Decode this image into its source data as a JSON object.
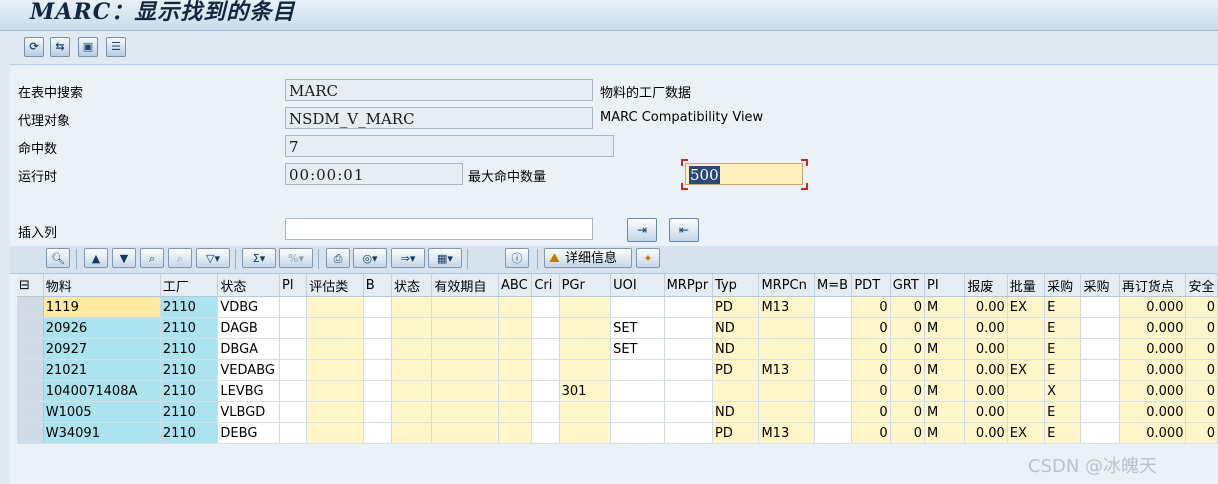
{
  "title": "MARC：显示找到的条目",
  "toolbar": {
    "icons": [
      "refresh-icon",
      "search-table-icon",
      "select-icon",
      "list-icon"
    ]
  },
  "form": {
    "table_label": "在表中搜索",
    "table_value": "MARC",
    "table_desc": "物料的工厂数据",
    "proxy_label": "代理对象",
    "proxy_value": "NSDM_V_MARC",
    "proxy_desc": "MARC Compatibility View",
    "hits_label": "命中数",
    "hits_value": "7",
    "runtime_label": "运行时",
    "runtime_value": "00:00:01",
    "max_hits_label": "最大命中数量",
    "max_hits_value": "500",
    "insert_col_label": "插入列",
    "insert_col_value": ""
  },
  "alv_toolbar": {
    "detail_label": "详细信息"
  },
  "grid": {
    "headers": [
      "物料",
      "工厂",
      "状态",
      "Pl",
      "评估类",
      "B",
      "状态",
      "有效期自",
      "ABC",
      "Cri",
      "PGr",
      "UOI",
      "MRPpr",
      "Typ",
      "MRPCn",
      "M=B",
      "PDT",
      "GRT",
      "PI",
      "报废",
      "批量",
      "采购",
      "采购",
      "再订货点",
      "安全"
    ],
    "rows": [
      [
        "1119",
        "2110",
        "VDBG",
        "",
        "",
        "",
        "",
        "",
        "",
        "",
        "",
        "",
        "",
        "PD",
        "M13",
        "",
        "0",
        "0",
        "M",
        "0.00",
        "EX",
        "E",
        "",
        "0.000",
        "0"
      ],
      [
        "20926",
        "2110",
        "DAGB",
        "",
        "",
        "",
        "",
        "",
        "",
        "",
        "",
        "SET",
        "",
        "ND",
        "",
        "",
        "0",
        "0",
        "M",
        "0.00",
        "",
        "E",
        "",
        "0.000",
        "0"
      ],
      [
        "20927",
        "2110",
        "DBGA",
        "",
        "",
        "",
        "",
        "",
        "",
        "",
        "",
        "SET",
        "",
        "ND",
        "",
        "",
        "0",
        "0",
        "M",
        "0.00",
        "",
        "E",
        "",
        "0.000",
        "0"
      ],
      [
        "21021",
        "2110",
        "VEDABG",
        "",
        "",
        "",
        "",
        "",
        "",
        "",
        "",
        "",
        "",
        "PD",
        "M13",
        "",
        "0",
        "0",
        "M",
        "0.00",
        "EX",
        "E",
        "",
        "0.000",
        "0"
      ],
      [
        "1040071408A",
        "2110",
        "LEVBG",
        "",
        "",
        "",
        "",
        "",
        "",
        "",
        "301",
        "",
        "",
        "",
        "",
        "",
        "0",
        "0",
        "M",
        "0.00",
        "",
        "X",
        "",
        "0.000",
        "0"
      ],
      [
        "W1005",
        "2110",
        "VLBGD",
        "",
        "",
        "",
        "",
        "",
        "",
        "",
        "",
        "",
        "",
        "ND",
        "",
        "",
        "0",
        "0",
        "M",
        "0.00",
        "",
        "E",
        "",
        "0.000",
        "0"
      ],
      [
        "W34091",
        "2110",
        "DEBG",
        "",
        "",
        "",
        "",
        "",
        "",
        "",
        "",
        "",
        "",
        "PD",
        "M13",
        "",
        "0",
        "0",
        "M",
        "0.00",
        "EX",
        "E",
        "",
        "0.000",
        "0"
      ]
    ]
  },
  "watermark": "CSDN @冰魄天"
}
